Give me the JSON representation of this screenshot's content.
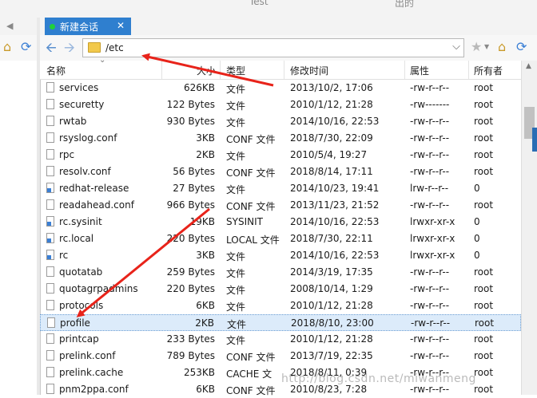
{
  "top_cut": {
    "left": "Test",
    "right": "出的"
  },
  "tab": {
    "label": "新建会话",
    "close": "✕"
  },
  "toolbar": {
    "back": "🡨",
    "forward": "🡪",
    "path": "/etc",
    "dropdown": "⌵",
    "star": "★",
    "home": "⌂",
    "refresh": "⟳"
  },
  "columns": {
    "name": "名称",
    "size": "大小",
    "type": "类型",
    "mtime": "修改时间",
    "perm": "属性",
    "owner": "所有者"
  },
  "rows": [
    {
      "name": "services",
      "size": "626KB",
      "type": "文件",
      "mtime": "2013/10/2, 17:06",
      "perm": "-rw-r--r--",
      "owner": "root",
      "icon": "file"
    },
    {
      "name": "securetty",
      "size": "122 Bytes",
      "type": "文件",
      "mtime": "2010/1/12, 21:28",
      "perm": "-rw-------",
      "owner": "root",
      "icon": "file"
    },
    {
      "name": "rwtab",
      "size": "930 Bytes",
      "type": "文件",
      "mtime": "2014/10/16, 22:53",
      "perm": "-rw-r--r--",
      "owner": "root",
      "icon": "file"
    },
    {
      "name": "rsyslog.conf",
      "size": "3KB",
      "type": "CONF 文件",
      "mtime": "2018/7/30, 22:09",
      "perm": "-rw-r--r--",
      "owner": "root",
      "icon": "file"
    },
    {
      "name": "rpc",
      "size": "2KB",
      "type": "文件",
      "mtime": "2010/5/4, 19:27",
      "perm": "-rw-r--r--",
      "owner": "root",
      "icon": "file"
    },
    {
      "name": "resolv.conf",
      "size": "56 Bytes",
      "type": "CONF 文件",
      "mtime": "2018/8/14, 17:11",
      "perm": "-rw-r--r--",
      "owner": "root",
      "icon": "file"
    },
    {
      "name": "redhat-release",
      "size": "27 Bytes",
      "type": "文件",
      "mtime": "2014/10/23, 19:41",
      "perm": "lrw-r--r--",
      "owner": "0",
      "icon": "link"
    },
    {
      "name": "readahead.conf",
      "size": "966 Bytes",
      "type": "CONF 文件",
      "mtime": "2013/11/23, 21:52",
      "perm": "-rw-r--r--",
      "owner": "root",
      "icon": "file"
    },
    {
      "name": "rc.sysinit",
      "size": "19KB",
      "type": "SYSINIT",
      "mtime": "2014/10/16, 22:53",
      "perm": "lrwxr-xr-x",
      "owner": "0",
      "icon": "link"
    },
    {
      "name": "rc.local",
      "size": "220 Bytes",
      "type": "LOCAL 文件",
      "mtime": "2018/7/30, 22:11",
      "perm": "lrwxr-xr-x",
      "owner": "0",
      "icon": "link"
    },
    {
      "name": "rc",
      "size": "3KB",
      "type": "文件",
      "mtime": "2014/10/16, 22:53",
      "perm": "lrwxr-xr-x",
      "owner": "0",
      "icon": "link"
    },
    {
      "name": "quotatab",
      "size": "259 Bytes",
      "type": "文件",
      "mtime": "2014/3/19, 17:35",
      "perm": "-rw-r--r--",
      "owner": "root",
      "icon": "file"
    },
    {
      "name": "quotagrpadmins",
      "size": "220 Bytes",
      "type": "文件",
      "mtime": "2008/10/14, 1:29",
      "perm": "-rw-r--r--",
      "owner": "root",
      "icon": "file"
    },
    {
      "name": "protocols",
      "size": "6KB",
      "type": "文件",
      "mtime": "2010/1/12, 21:28",
      "perm": "-rw-r--r--",
      "owner": "root",
      "icon": "file"
    },
    {
      "name": "profile",
      "size": "2KB",
      "type": "文件",
      "mtime": "2018/8/10, 23:00",
      "perm": "-rw-r--r--",
      "owner": "root",
      "icon": "file",
      "selected": true
    },
    {
      "name": "printcap",
      "size": "233 Bytes",
      "type": "文件",
      "mtime": "2010/1/12, 21:28",
      "perm": "-rw-r--r--",
      "owner": "root",
      "icon": "file"
    },
    {
      "name": "prelink.conf",
      "size": "789 Bytes",
      "type": "CONF 文件",
      "mtime": "2013/7/19, 22:35",
      "perm": "-rw-r--r--",
      "owner": "root",
      "icon": "file"
    },
    {
      "name": "prelink.cache",
      "size": "253KB",
      "type": "CACHE 文",
      "mtime": "2018/8/11, 0:39",
      "perm": "-rw-r--r--",
      "owner": "root",
      "icon": "file"
    },
    {
      "name": "pnm2ppa.conf",
      "size": "6KB",
      "type": "CONF 文件",
      "mtime": "2010/8/23, 7:28",
      "perm": "-rw-r--r--",
      "owner": "root",
      "icon": "file"
    }
  ],
  "watermark": "http://blog.csdn.net/miwanmeng",
  "colors": {
    "tab_active": "#2f7fcf",
    "selection": "#dcebfa",
    "annotation_arrow": "#e8231a"
  }
}
